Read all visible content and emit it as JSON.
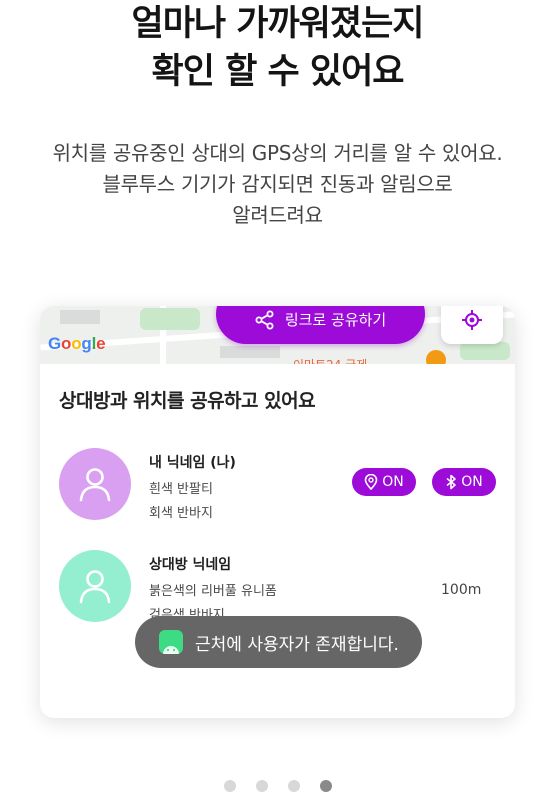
{
  "headline": {
    "line1": "얼마나 가까워졌는지",
    "line2": "확인 할 수 있어요"
  },
  "description": {
    "line1": "위치를 공유중인 상대의 GPS상의 거리를 알 수 있어요.",
    "line2": "블루투스 기기가 감지되면 진동과 알림으로",
    "line3": "알려드려요"
  },
  "map": {
    "logo": "Google",
    "share_button_label": "링크로 공유하기",
    "partial_place_label": "이마트24 국제..."
  },
  "card": {
    "title": "상대방과 위치를 공유하고 있어요",
    "users": [
      {
        "name": "내 닉네임 (나)",
        "top": "흰색 반팔티",
        "bottom": "회색 반바지",
        "avatar_color": "#d9a0f2",
        "gps_label": "ON",
        "bluetooth_label": "ON"
      },
      {
        "name": "상대방 닉네임",
        "top": "붉은색의 리버풀 유니폼",
        "bottom": "검은색 반바지",
        "avatar_color": "#93efd0",
        "distance": "100m"
      }
    ]
  },
  "toast": {
    "message": "근처에 사용자가 존재합니다."
  },
  "pagination": {
    "total": 4,
    "active_index": 3
  },
  "colors": {
    "accent": "#9c0bd8",
    "toast_bg": "#666666",
    "android_green": "#3ddc84"
  }
}
